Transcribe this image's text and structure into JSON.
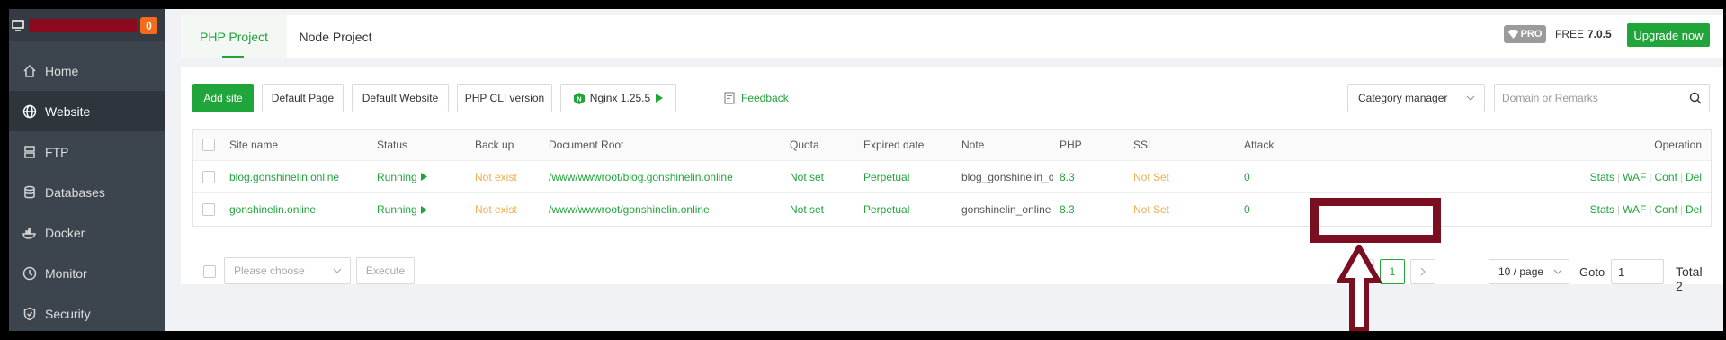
{
  "sidebar": {
    "badge": "0",
    "items": [
      {
        "label": "Home",
        "icon": "home-icon"
      },
      {
        "label": "Website",
        "icon": "globe-icon",
        "active": true
      },
      {
        "label": "FTP",
        "icon": "ftp-icon"
      },
      {
        "label": "Databases",
        "icon": "database-icon"
      },
      {
        "label": "Docker",
        "icon": "docker-icon"
      },
      {
        "label": "Monitor",
        "icon": "monitor-icon"
      },
      {
        "label": "Security",
        "icon": "shield-icon"
      }
    ]
  },
  "header": {
    "tabs": [
      {
        "label": "PHP Project",
        "active": true
      },
      {
        "label": "Node Project"
      }
    ],
    "pro_label": "PRO",
    "free_label": "FREE",
    "version": "7.0.5",
    "upgrade_label": "Upgrade now"
  },
  "toolbar": {
    "add_site": "Add site",
    "default_page": "Default Page",
    "default_website": "Default Website",
    "php_cli": "PHP CLI version",
    "nginx": "Nginx 1.25.5",
    "feedback": "Feedback",
    "category": "Category manager",
    "search_placeholder": "Domain or Remarks"
  },
  "table": {
    "headers": {
      "site_name": "Site name",
      "status": "Status",
      "backup": "Back up",
      "doc_root": "Document Root",
      "quota": "Quota",
      "expired": "Expired date",
      "note": "Note",
      "php": "PHP",
      "ssl": "SSL",
      "attack": "Attack",
      "operation": "Operation"
    },
    "rows": [
      {
        "site": "blog.gonshinelin.online",
        "status": "Running",
        "backup": "Not exist",
        "root": "/www/wwwroot/blog.gonshinelin.online",
        "quota": "Not set",
        "expired": "Perpetual",
        "note": "blog_gonshinelin_onli",
        "php": "8.3",
        "ssl": "Not Set",
        "attack": "0"
      },
      {
        "site": "gonshinelin.online",
        "status": "Running",
        "backup": "Not exist",
        "root": "/www/wwwroot/gonshinelin.online",
        "quota": "Not set",
        "expired": "Perpetual",
        "note": "gonshinelin_online",
        "php": "8.3",
        "ssl": "Not Set",
        "attack": "0"
      }
    ],
    "ops": {
      "stats": "Stats",
      "waf": "WAF",
      "conf": "Conf",
      "del": "Del"
    }
  },
  "footer": {
    "batch_placeholder": "Please choose",
    "execute": "Execute",
    "current_page": "1",
    "per_page": "10 / page",
    "goto_label": "Goto",
    "goto_value": "1",
    "total": "Total 2"
  },
  "colors": {
    "accent": "#20a53a",
    "warning": "#f0ad4e",
    "annotation": "#7a0f22"
  }
}
